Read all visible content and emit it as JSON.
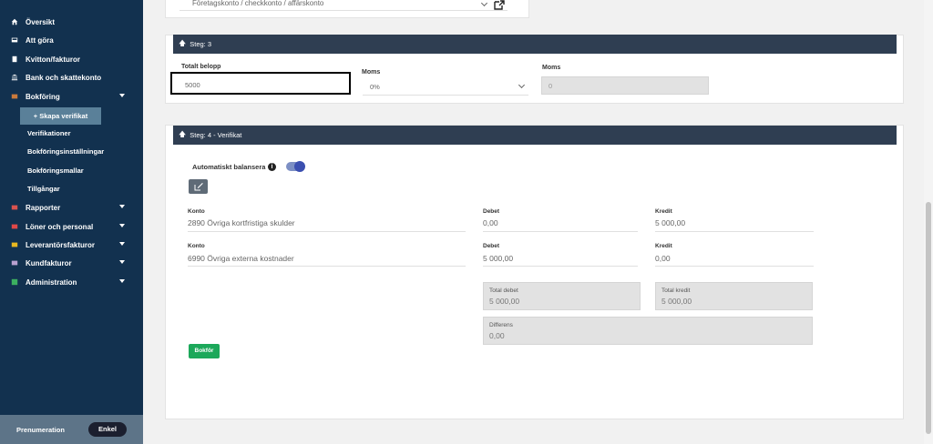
{
  "sidebar": {
    "items": [
      {
        "label": "Översikt",
        "icon": "home-icon"
      },
      {
        "label": "Att göra",
        "icon": "inbox-icon"
      },
      {
        "label": "Kvitton/fakturor",
        "icon": "receipt-icon"
      },
      {
        "label": "Bank och skattekonto",
        "icon": "bank-icon"
      },
      {
        "label": "Bokföring",
        "icon": "ledger-icon"
      },
      {
        "label": "Rapporter",
        "icon": "report-icon"
      },
      {
        "label": "Löner och personal",
        "icon": "payroll-icon"
      },
      {
        "label": "Leverantörsfakturor",
        "icon": "supplier-icon"
      },
      {
        "label": "Kundfakturor",
        "icon": "customer-icon"
      },
      {
        "label": "Administration",
        "icon": "admin-icon"
      }
    ],
    "bokforing_sub": {
      "active": "+ Skapa verifikat",
      "items": [
        "Verifikationer",
        "Bokföringsinställningar",
        "Bokföringsmallar",
        "Tillgångar"
      ]
    },
    "footer": {
      "label": "Prenumeration",
      "plan_button": "Enkel"
    }
  },
  "top_select": {
    "value": "Företagskonto / checkkonto / affärskonto"
  },
  "step3": {
    "title": "Steg: 3",
    "totalt_belopp_label": "Totalt belopp",
    "totalt_belopp_value": "5000",
    "moms_label": "Moms",
    "moms_value": "0%",
    "moms2_label": "Moms",
    "moms2_value": "0"
  },
  "step4": {
    "title": "Steg: 4 - Verifikat",
    "auto_balance_label": "Automatiskt balansera",
    "auto_balance_on": true,
    "rows": [
      {
        "konto_label": "Konto",
        "konto": "2890 Övriga kortfristiga skulder",
        "debet_label": "Debet",
        "debet": "0,00",
        "kredit_label": "Kredit",
        "kredit": "5 000,00"
      },
      {
        "konto_label": "Konto",
        "konto": "6990 Övriga externa kostnader",
        "debet_label": "Debet",
        "debet": "5 000,00",
        "kredit_label": "Kredit",
        "kredit": "0,00"
      }
    ],
    "total_debet_label": "Total debet",
    "total_debet": "5 000,00",
    "total_kredit_label": "Total kredit",
    "total_kredit": "5 000,00",
    "differens_label": "Differens",
    "differens": "0,00",
    "submit_label": "Bokför"
  },
  "colors": {
    "sidebar_bg": "#12314f",
    "step_header_bg": "#2f3e52",
    "submit_green": "#1ca85a",
    "toggle": "#3b4fb0"
  }
}
